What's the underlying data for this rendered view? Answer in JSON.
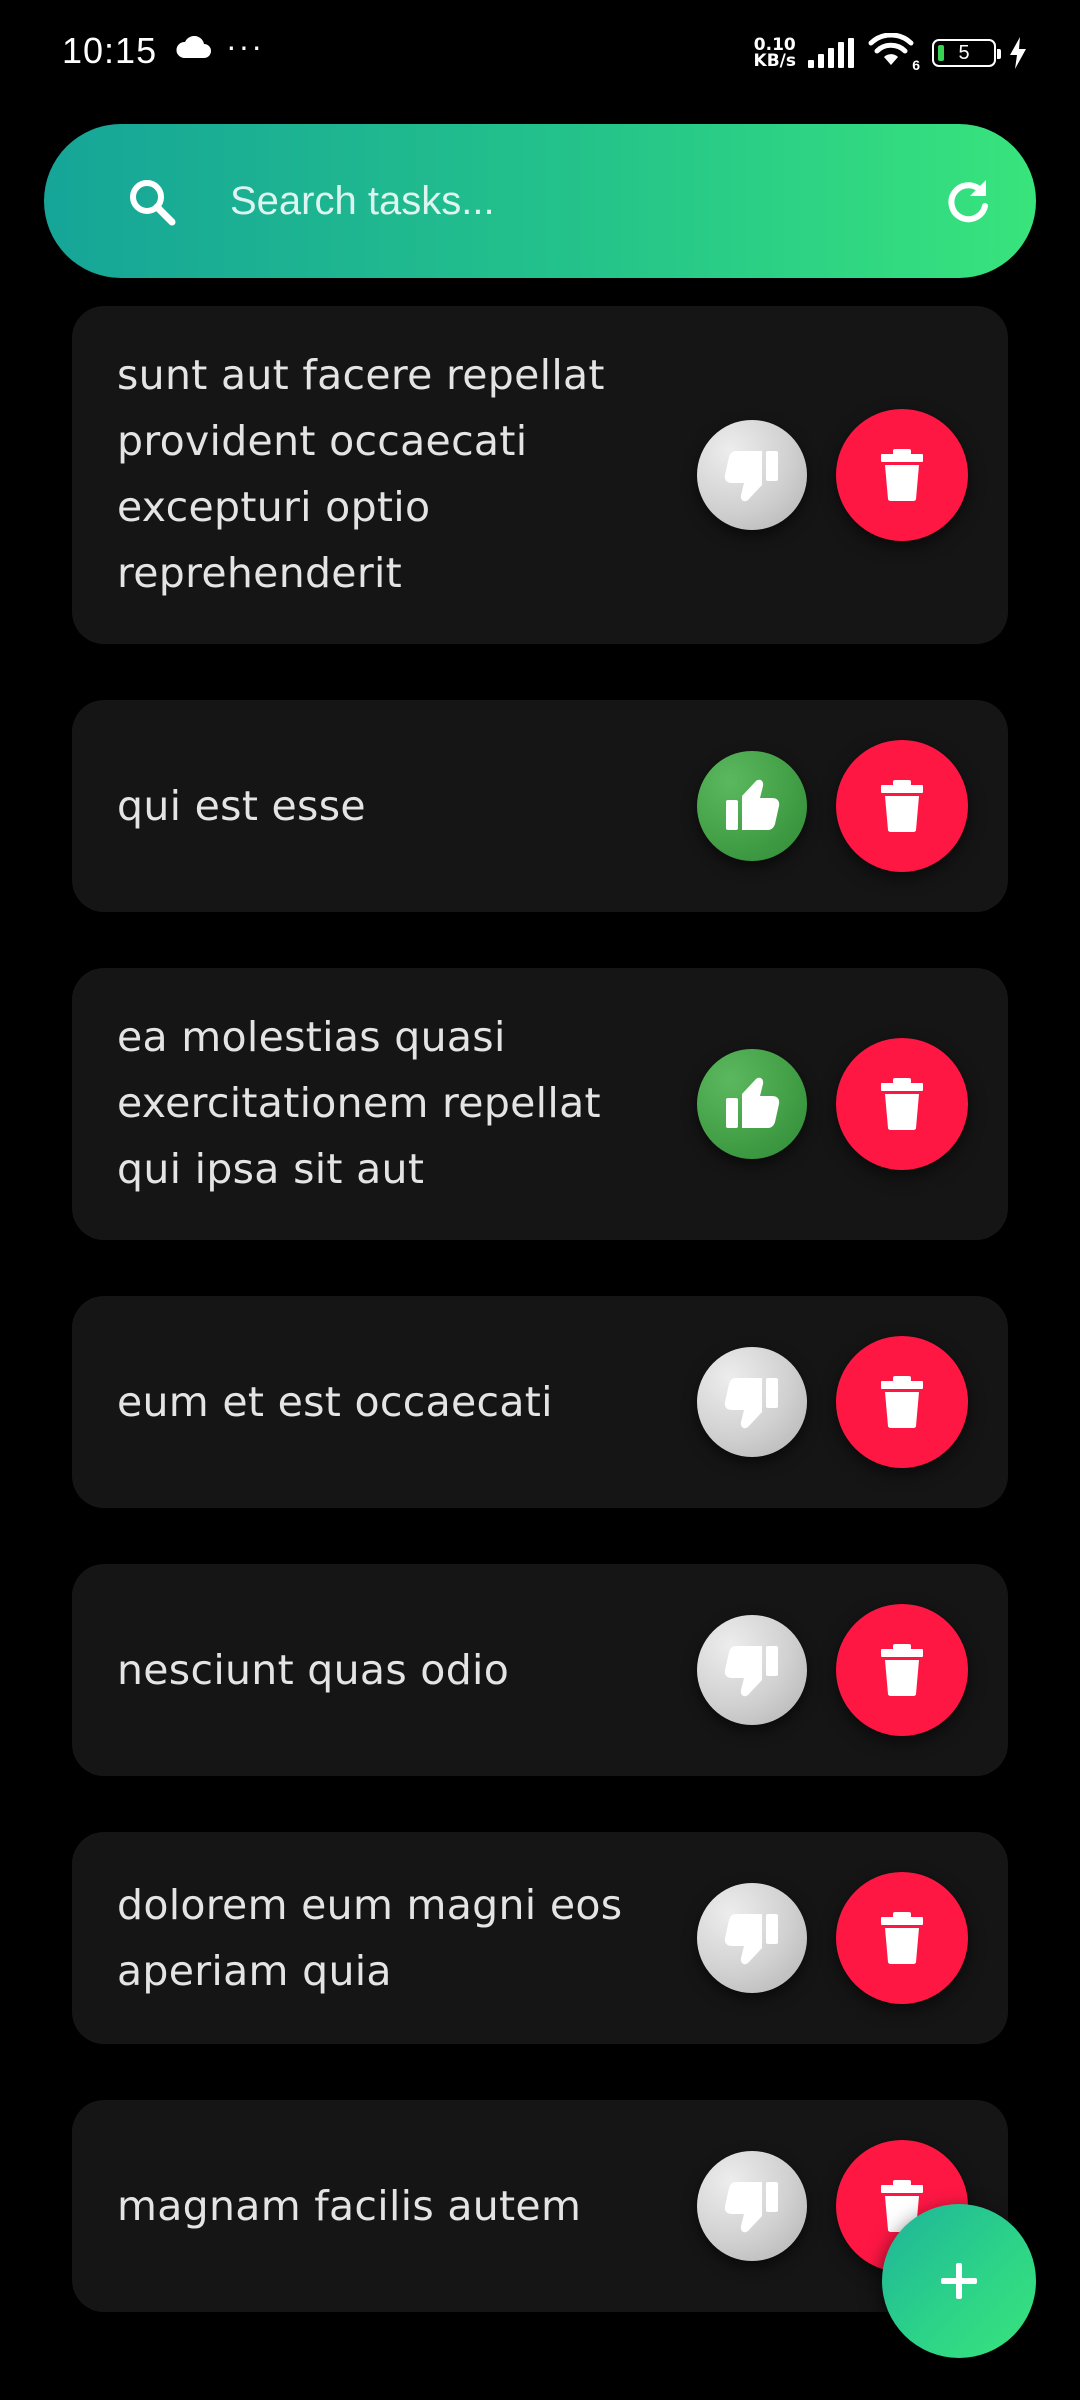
{
  "status_bar": {
    "time": "10:15",
    "more_indicator": "···",
    "net_speed_value": "0.10",
    "net_speed_unit": "KB/s",
    "wifi_badge": "6",
    "battery_level": "5",
    "icons": [
      "cloud-icon",
      "signal-icon",
      "wifi-icon",
      "battery-icon",
      "charging-icon"
    ]
  },
  "search": {
    "placeholder": "Search tasks...",
    "value": "",
    "icon": "search-icon",
    "refresh_icon": "refresh-icon"
  },
  "tasks": [
    {
      "title": "sunt aut facere repellat provident occaecati excepturi optio reprehenderit",
      "status": "disliked"
    },
    {
      "title": "qui est esse",
      "status": "liked"
    },
    {
      "title": "ea molestias quasi exercitationem repellat qui ipsa sit aut",
      "status": "liked"
    },
    {
      "title": "eum et est occaecati",
      "status": "disliked"
    },
    {
      "title": "nesciunt quas odio",
      "status": "disliked"
    },
    {
      "title": "dolorem eum magni eos aperiam quia",
      "status": "disliked"
    },
    {
      "title": "magnam facilis autem",
      "status": "disliked"
    }
  ],
  "fab": {
    "icon": "plus-icon"
  },
  "colors": {
    "background": "#000000",
    "card": "#141514",
    "gradient_start": "#16a598",
    "gradient_end": "#38e47c",
    "delete": "#ff1744",
    "liked": "#43a047",
    "disliked": "#d0d0d0"
  }
}
